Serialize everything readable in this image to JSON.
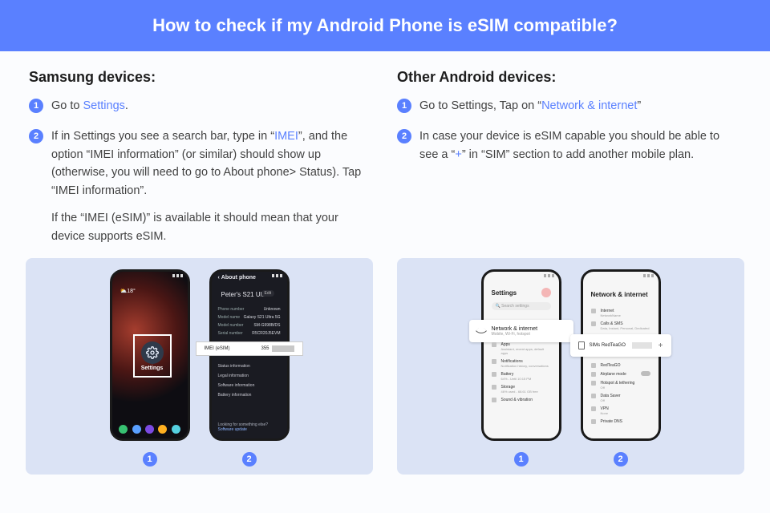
{
  "header": {
    "title": "How to check if my Android Phone is eSIM compatible?"
  },
  "samsung": {
    "heading": "Samsung devices:",
    "steps": [
      {
        "num": "1",
        "before": "Go to ",
        "link": "Settings",
        "after": "."
      },
      {
        "num": "2",
        "before": "If in Settings you see a search bar, type in “",
        "link": "IMEI",
        "after": "”, and the option “IMEI information” (or similar) should show up (otherwise, you will need to go to About phone> Status). Tap “IMEI information”.",
        "extra": "If the “IMEI (eSIM)” is available it should mean that your device supports eSIM."
      }
    ],
    "phone1": {
      "weather": "⛅18°",
      "icon_label": "Settings",
      "dock_colors": [
        "#38c172",
        "#5aa0ff",
        "#7b4ae2",
        "#ffb020",
        "#55d0e0"
      ]
    },
    "phone2": {
      "back_title": "About phone",
      "device_name": "Peter's S21 Ultra",
      "edit": "Edit",
      "rows": [
        {
          "k": "Phone number",
          "v": "Unknown"
        },
        {
          "k": "Model name",
          "v": "Galaxy S21 Ultra 5G"
        },
        {
          "k": "Model number",
          "v": "SM-G998B/DS"
        },
        {
          "k": "Serial number",
          "v": "R5CR20J5EVM"
        }
      ],
      "callout_label": "IMEI (eSIM)",
      "callout_value_prefix": "355",
      "sections": [
        "Status information",
        "Legal information",
        "Software information",
        "Battery information"
      ],
      "footer_q": "Looking for something else?",
      "footer_link": "Software update"
    },
    "indices": [
      "1",
      "2"
    ]
  },
  "android": {
    "heading": "Other Android devices:",
    "steps": [
      {
        "num": "1",
        "before": "Go to Settings, Tap on “",
        "link": "Network & internet",
        "after": "”"
      },
      {
        "num": "2",
        "before": "In case your device is eSIM capable you should be able to see a “",
        "link": "+",
        "after": "” in “SIM” section to add another mobile plan."
      }
    ],
    "phone1": {
      "title": "Settings",
      "search_placeholder": "🔍  Search settings",
      "callout_title": "Network & internet",
      "callout_sub": "Mobile, Wi-Fi, hotspot",
      "items": [
        {
          "t": "Apps",
          "s": "Assistant, recent apps, default apps"
        },
        {
          "t": "Notifications",
          "s": "Notification history, conversations"
        },
        {
          "t": "Battery",
          "s": "64% - Until 10:15 PM"
        },
        {
          "t": "Storage",
          "s": "46% used - 68.61 GB free"
        },
        {
          "t": "Sound & vibration",
          "s": ""
        }
      ]
    },
    "phone2": {
      "title": "Network & internet",
      "items_top": [
        {
          "t": "Internet",
          "s": "NetworkName"
        },
        {
          "t": "Calls & SMS",
          "s": "Data, Instant, Personal, Dedicated"
        }
      ],
      "callout_title": "SIMs",
      "callout_sub": "RedTeaGO",
      "plus": "+",
      "items_bottom": [
        {
          "t": "RedTeaGO",
          "s": "",
          "toggle": true
        },
        {
          "t": "Airplane mode",
          "s": "",
          "toggle": true
        },
        {
          "t": "Hotspot & tethering",
          "s": "Off"
        },
        {
          "t": "Data Saver",
          "s": "Off"
        },
        {
          "t": "VPN",
          "s": "None"
        },
        {
          "t": "Private DNS",
          "s": ""
        }
      ]
    },
    "indices": [
      "1",
      "2"
    ]
  }
}
